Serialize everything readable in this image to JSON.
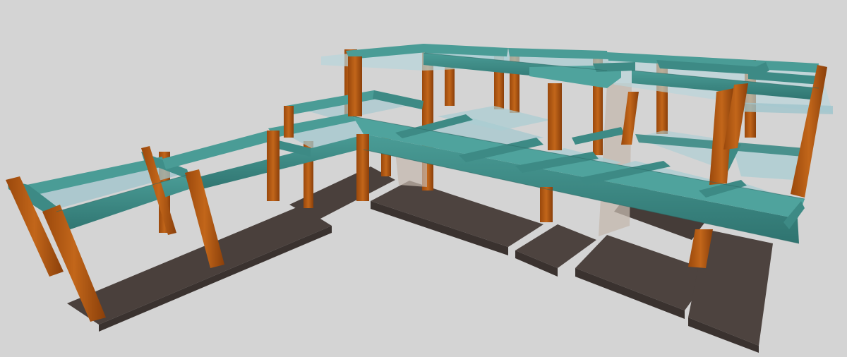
{
  "scene": {
    "view": "3d-axonometric",
    "background_color": "#d4d4d4",
    "element_types": [
      {
        "name": "foundation-slab",
        "color": "#4e4440"
      },
      {
        "name": "column",
        "color": "#b65a12"
      },
      {
        "name": "beam",
        "color": "#3d8a85"
      },
      {
        "name": "floor-panel",
        "color": "#9fc6cc"
      },
      {
        "name": "core-wall",
        "color": "#b9aea4"
      }
    ],
    "counts": {
      "foundation_slabs": 8,
      "columns": 24,
      "beam_levels": 2
    }
  }
}
